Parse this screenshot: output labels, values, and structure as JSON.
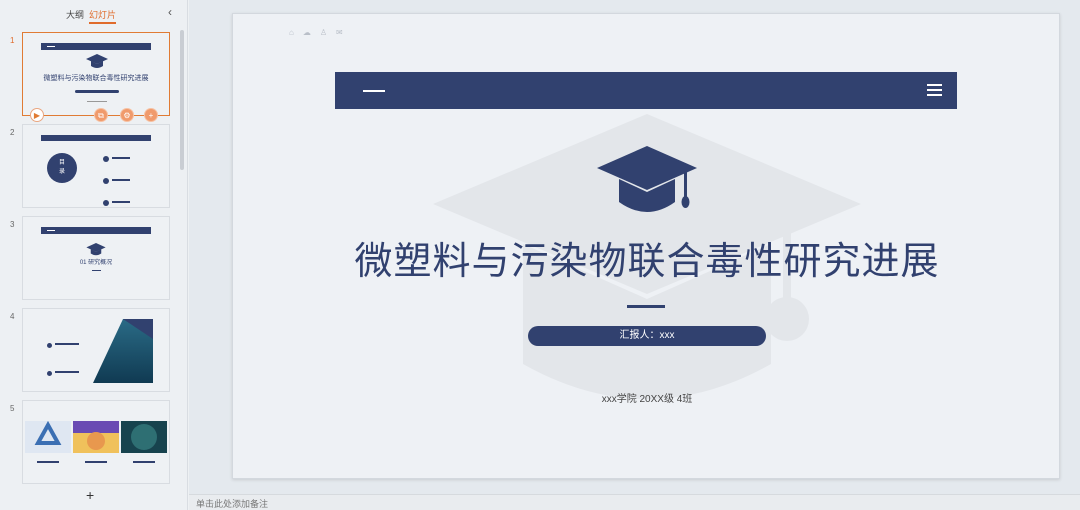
{
  "panel": {
    "tab_outline": "大纲",
    "tab_slides": "幻灯片",
    "collapse_icon": "chevron-left-icon",
    "add_slide": "+"
  },
  "thumbnails": [
    {
      "number": "1",
      "title": "微塑料与污染物联合毒性研究进展"
    },
    {
      "number": "2",
      "badge_line1": "目",
      "badge_line2": "录"
    },
    {
      "number": "3",
      "title": "01 研究概况"
    },
    {
      "number": "4"
    },
    {
      "number": "5"
    }
  ],
  "thumb_actions": [
    "play-icon",
    "copy-icon",
    "settings-icon",
    "add-icon"
  ],
  "slide": {
    "title": "微塑料与污染物联合毒性研究进展",
    "reporter": "汇报人：xxx",
    "subtitle": "xxx学院  20XX级  4班"
  },
  "notes": {
    "placeholder": "单击此处添加备注"
  },
  "colors": {
    "primary": "#31416f",
    "accent": "#e06b2b"
  }
}
